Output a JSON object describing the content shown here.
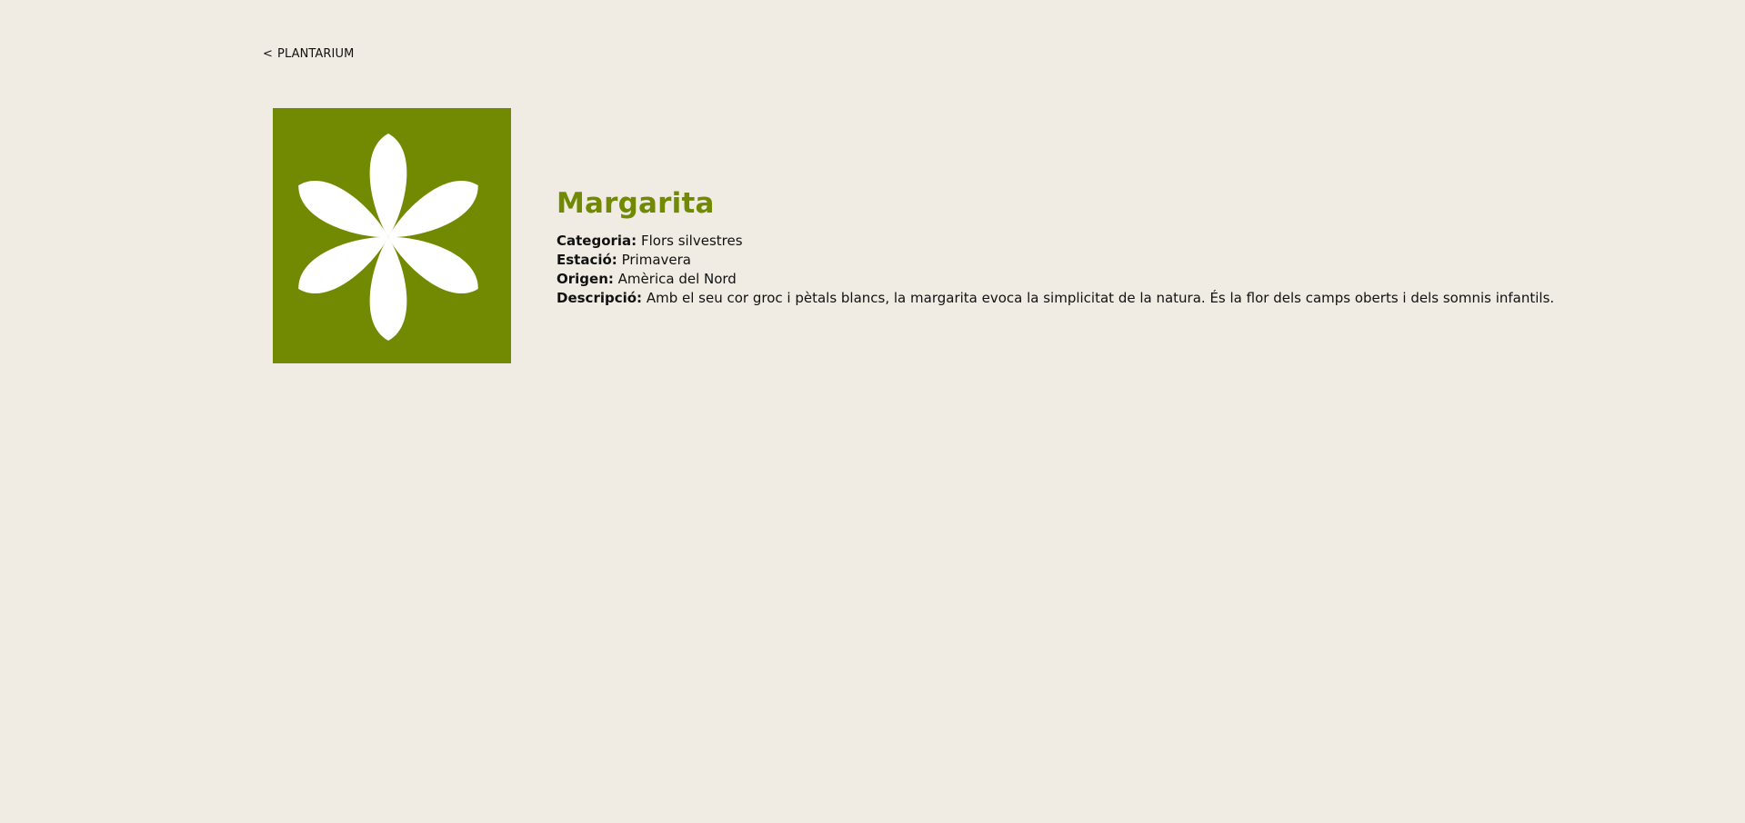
{
  "nav": {
    "back_chevron": "<",
    "back_label": "PLANTARIUM"
  },
  "plant": {
    "image_icon": "flower-icon",
    "image_background": "#728a02",
    "name": "Margarita",
    "fields": [
      {
        "label": "Categoria:",
        "value": "Flors silvestres"
      },
      {
        "label": "Estació:",
        "value": "Primavera"
      },
      {
        "label": "Origen:",
        "value": "Amèrica del Nord"
      },
      {
        "label": "Descripció:",
        "value": "Amb el seu cor groc i pètals blancs, la margarita evoca la simplicitat de la natura. És la flor dels camps oberts i dels somnis infantils."
      }
    ]
  },
  "colors": {
    "page_background": "#f0ece4",
    "accent": "#728a02",
    "text": "#111111",
    "petal": "#ffffff"
  }
}
